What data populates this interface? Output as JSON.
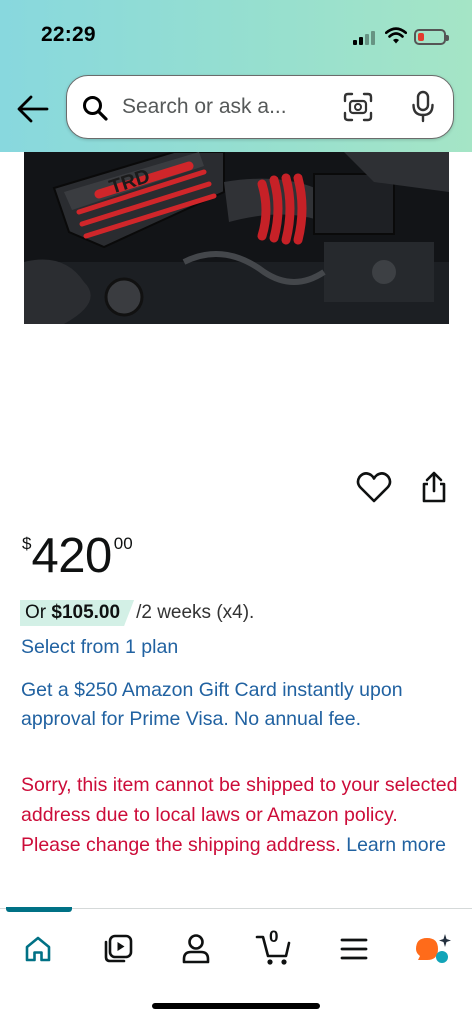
{
  "status_bar": {
    "time": "22:29"
  },
  "search": {
    "placeholder": "Search or ask a..."
  },
  "product": {
    "image_alt": "TRD engine intake",
    "image_logo": "TRD"
  },
  "price": {
    "symbol": "$",
    "whole": "420",
    "fraction": "00"
  },
  "installment": {
    "prefix": "Or ",
    "amount": "$105.00",
    "term": "/2 weeks (x4)."
  },
  "links": {
    "select_plan": "Select from 1 plan",
    "learn_more": "Learn more"
  },
  "promo": {
    "text": "Get a $250 Amazon Gift Card instantly upon approval for Prime Visa. No annual fee."
  },
  "warning": {
    "text": "Sorry, this item cannot be shipped to your selected address due to local laws or Amazon policy. Please change the shipping address. "
  },
  "tab_bar": {
    "cart_count": "0",
    "active_tab": "home",
    "tabs": [
      "home-icon",
      "video-icon",
      "account-icon",
      "cart-icon",
      "menu-icon",
      "assistant-icon"
    ]
  },
  "colors": {
    "link": "#2162a1",
    "warning": "#cc0c39",
    "accent": "#007185",
    "installment_bg": "#d3f0e6",
    "header_gradient": "#88d8de"
  }
}
